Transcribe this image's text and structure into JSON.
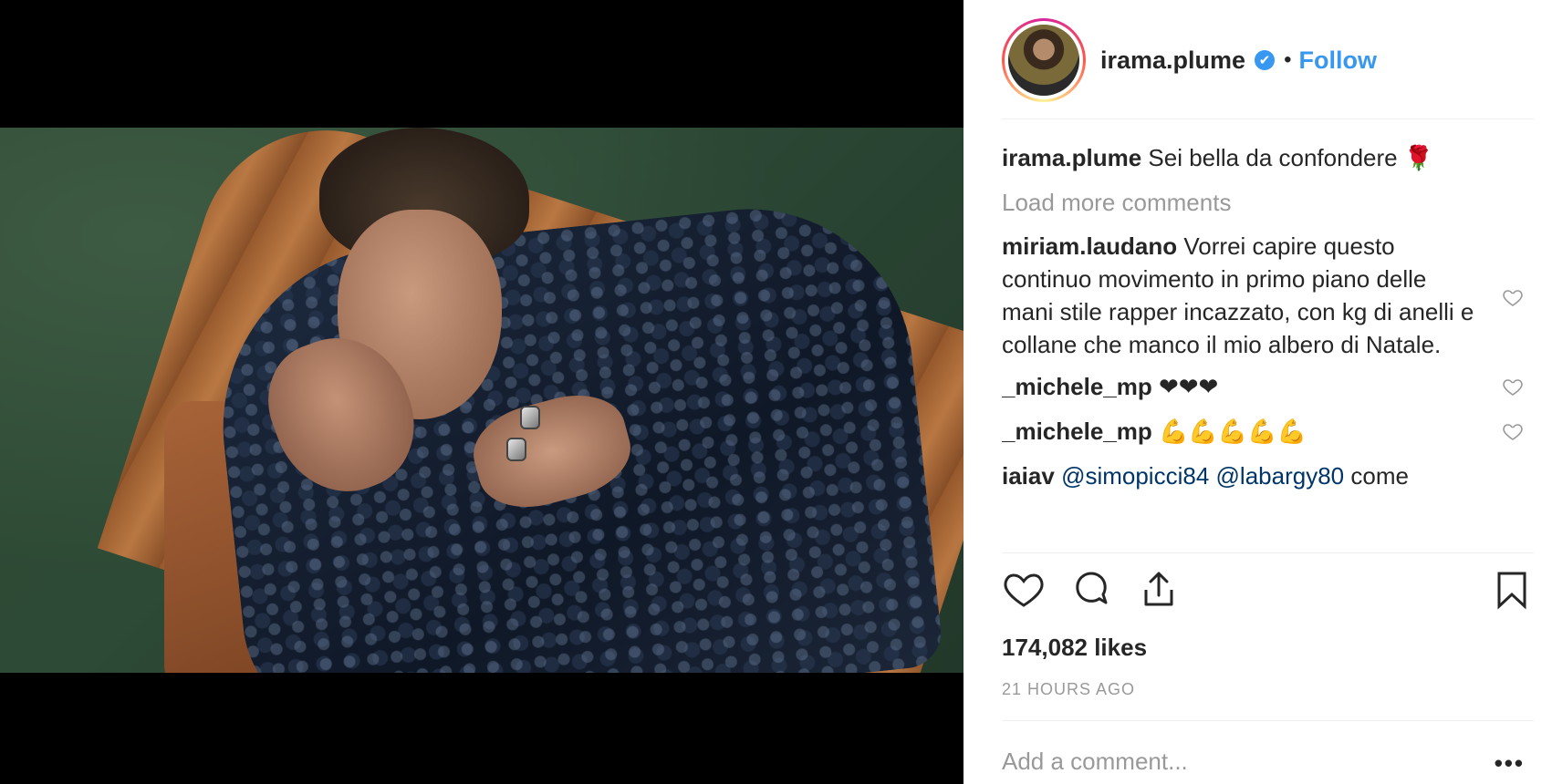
{
  "post": {
    "username": "irama.plume",
    "follow_label": "Follow",
    "separator": "•",
    "verified_mark": "✔"
  },
  "caption": {
    "user": "irama.plume",
    "text": "Sei bella da confondere",
    "emoji": "🌹"
  },
  "load_more": "Load more comments",
  "comments": [
    {
      "user": "miriam.laudano",
      "text": "Vorrei capire questo continuo movimento in primo piano delle mani stile rapper incazzato, con kg di anelli e collane che manco il mio albero di Natale."
    },
    {
      "user": "_michele_mp",
      "text": "❤❤❤"
    },
    {
      "user": "_michele_mp",
      "text": "💪💪💪💪💪"
    },
    {
      "user": "iaiav",
      "mention1": "@simopicci84",
      "mention2": "@labargy80",
      "text": "come"
    }
  ],
  "likes": "174,082 likes",
  "timestamp": "21 HOURS AGO",
  "add_comment_placeholder": "Add a comment...",
  "more_label": "•••",
  "icons": {
    "like": "heart-icon",
    "comment": "comment-icon",
    "share": "share-icon",
    "save": "bookmark-icon",
    "comment_like": "heart-icon"
  },
  "colors": {
    "link": "#3897f0",
    "mention": "#003569",
    "muted": "#999999",
    "text": "#262626"
  }
}
